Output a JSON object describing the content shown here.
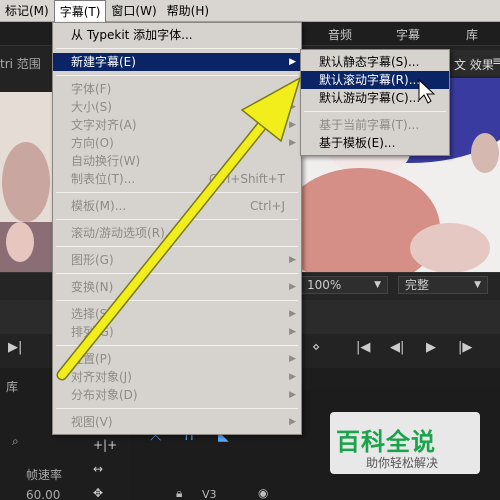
{
  "menubar": {
    "items": [
      "标记(M)",
      "字幕(T)",
      "窗口(W)",
      "帮助(H)"
    ]
  },
  "workspace_tabs": {
    "audio": "音频",
    "captions": "字幕",
    "libraries": "库"
  },
  "panels": {
    "left_tab": "tri 范围",
    "right_tab": "文 效果",
    "lower_tab": "库",
    "frame_rate_label": "帧速率",
    "frame_rate_value": "60.00",
    "track_label": "V3"
  },
  "monitor": {
    "zoom": "100%",
    "quality": "完整"
  },
  "title_menu": {
    "items": [
      {
        "label": "从 Typekit 添加字体...",
        "shortcut": "",
        "disabled": false,
        "submenu": false
      },
      {
        "sep": true
      },
      {
        "label": "新建字幕(E)",
        "shortcut": "",
        "disabled": false,
        "submenu": true,
        "highlighted": true
      },
      {
        "sep": true
      },
      {
        "label": "字体(F)",
        "shortcut": "",
        "disabled": true,
        "submenu": true
      },
      {
        "label": "大小(S)",
        "shortcut": "",
        "disabled": true,
        "submenu": true
      },
      {
        "label": "文字对齐(A)",
        "shortcut": "",
        "disabled": true,
        "submenu": true
      },
      {
        "label": "方向(O)",
        "shortcut": "",
        "disabled": true,
        "submenu": true
      },
      {
        "label": "自动换行(W)",
        "shortcut": "",
        "disabled": true,
        "submenu": false
      },
      {
        "label": "制表位(T)...",
        "shortcut": "Ctrl+Shift+T",
        "disabled": true,
        "submenu": false
      },
      {
        "sep": true
      },
      {
        "label": "模板(M)...",
        "shortcut": "Ctrl+J",
        "disabled": true,
        "submenu": false
      },
      {
        "sep": true
      },
      {
        "label": "滚动/游动选项(R)...",
        "shortcut": "",
        "disabled": true,
        "submenu": false
      },
      {
        "sep": true
      },
      {
        "label": "图形(G)",
        "shortcut": "",
        "disabled": true,
        "submenu": true
      },
      {
        "sep": true
      },
      {
        "label": "变换(N)",
        "shortcut": "",
        "disabled": true,
        "submenu": true
      },
      {
        "sep": true
      },
      {
        "label": "选择(S)",
        "shortcut": "",
        "disabled": true,
        "submenu": true
      },
      {
        "label": "排列(G)",
        "shortcut": "",
        "disabled": true,
        "submenu": true
      },
      {
        "sep": true
      },
      {
        "label": "位置(P)",
        "shortcut": "",
        "disabled": true,
        "submenu": true
      },
      {
        "label": "对齐对象(J)",
        "shortcut": "",
        "disabled": true,
        "submenu": true
      },
      {
        "label": "分布对象(D)",
        "shortcut": "",
        "disabled": true,
        "submenu": true
      },
      {
        "sep": true
      },
      {
        "label": "视图(V)",
        "shortcut": "",
        "disabled": true,
        "submenu": true
      }
    ]
  },
  "new_title_submenu": {
    "items": [
      {
        "label": "默认静态字幕(S)...",
        "disabled": false
      },
      {
        "label": "默认滚动字幕(R)...",
        "disabled": false,
        "highlighted": true
      },
      {
        "label": "默认游动字幕(C)...",
        "disabled": false
      },
      {
        "sep": true
      },
      {
        "label": "基于当前字幕(T)...",
        "disabled": true
      },
      {
        "label": "基于模板(E)...",
        "disabled": false
      }
    ]
  },
  "watermark": {
    "title": "百科全说",
    "subtitle": "助你轻松解决"
  },
  "colors": {
    "arrow": "#f2ee1c",
    "highlight": "#0a2466",
    "menu_bg": "#d6d3ce"
  }
}
